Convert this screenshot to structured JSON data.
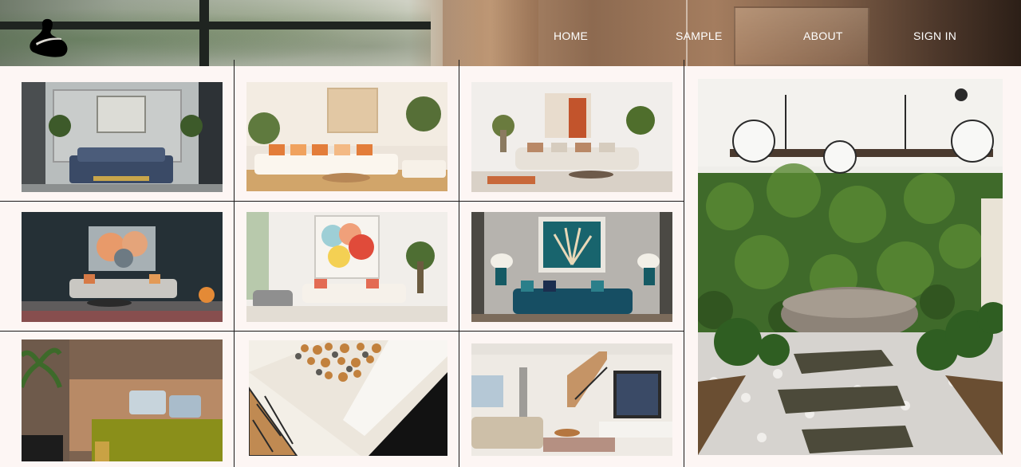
{
  "nav": {
    "items": [
      "HOME",
      "SAMPLE",
      "ABOUT",
      "SIGN IN"
    ]
  },
  "icons": {
    "logo": "abstract-wave-logo"
  },
  "gallery": {
    "tiles": [
      "classic-gray-living-room",
      "sunny-orange-pillows-living-room",
      "minimal-white-living-room-with-plants",
      "dark-living-room-abstract-art",
      "bright-living-room-colorful-art",
      "navy-velvet-sofa-living-room",
      "olive-bed-bedroom",
      "mosaic-tile-closeup",
      "modern-staircase-living-room"
    ],
    "feature": "stone-bathtub-green-wall-bathroom"
  }
}
